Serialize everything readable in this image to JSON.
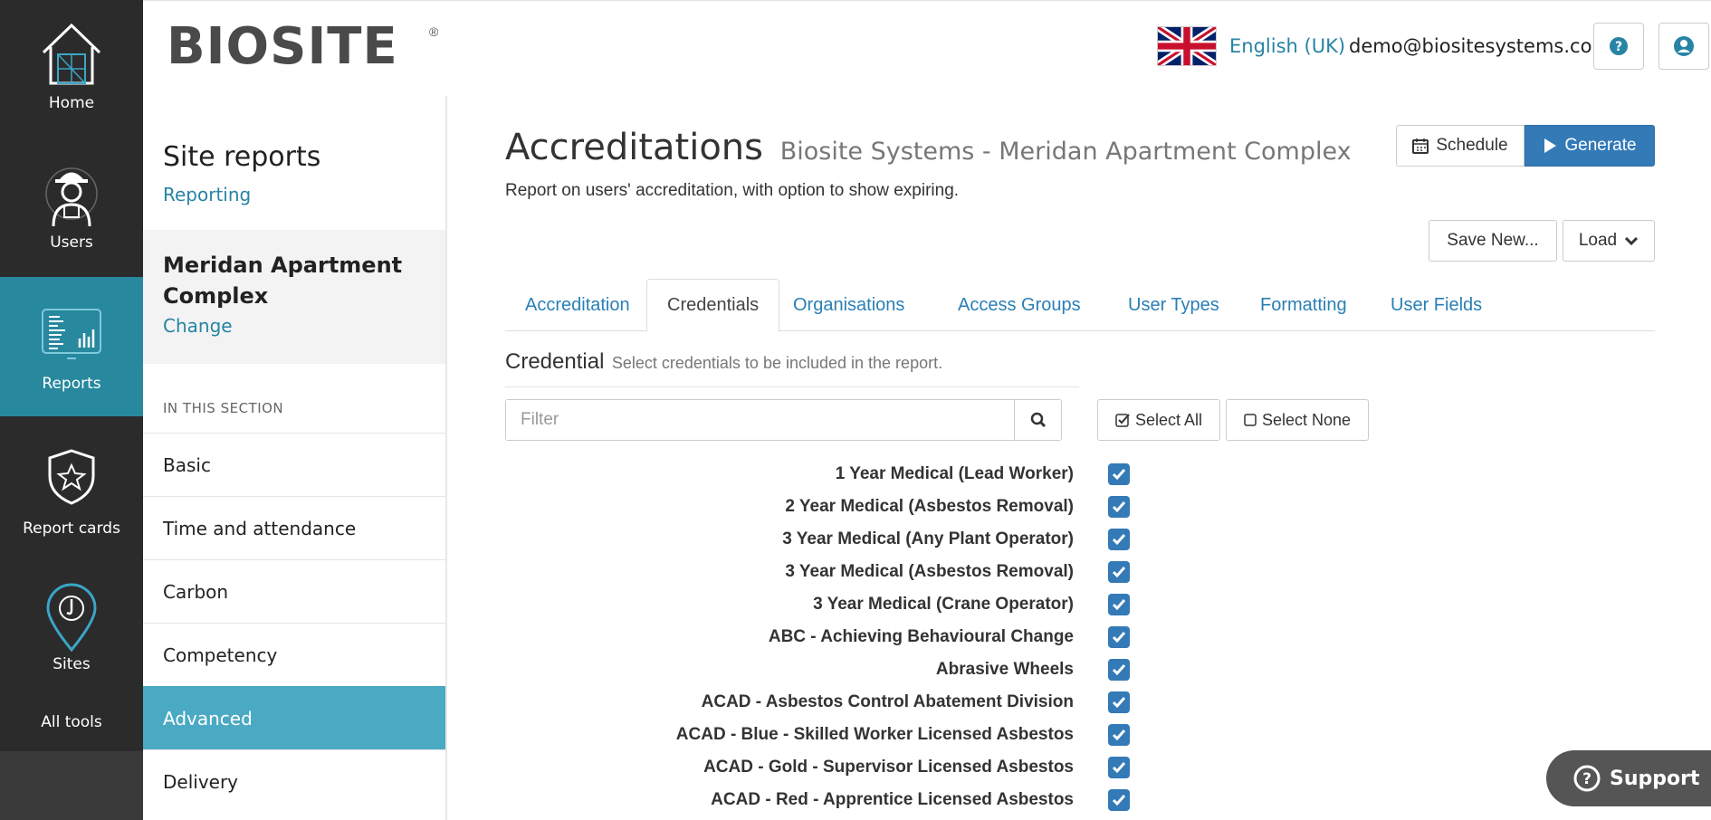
{
  "rail": {
    "items": [
      {
        "label": "Home",
        "icon": "home-icon"
      },
      {
        "label": "Users",
        "icon": "worker-icon"
      },
      {
        "label": "Reports",
        "icon": "report-icon",
        "active": true
      },
      {
        "label": "Report cards",
        "icon": "shield-star-icon"
      },
      {
        "label": "Sites",
        "icon": "location-pin-icon"
      },
      {
        "label": "All tools"
      }
    ]
  },
  "header": {
    "logo": "BIOSITE",
    "logo_mark": "®",
    "language": "English (UK)",
    "email": "demo@biositesystems.com",
    "help_icon": "question-icon",
    "account_icon": "user-icon"
  },
  "subnav": {
    "title": "Site reports",
    "link": "Reporting",
    "site_name": "Meridan Apartment Complex",
    "change_link": "Change",
    "section_label": "IN THIS SECTION",
    "items": [
      {
        "label": "Basic"
      },
      {
        "label": "Time and attendance"
      },
      {
        "label": "Carbon"
      },
      {
        "label": "Competency"
      },
      {
        "label": "Advanced",
        "active": true
      },
      {
        "label": "Delivery"
      }
    ]
  },
  "main": {
    "title": "Accreditations",
    "subtitle": "Biosite Systems - Meridan Apartment Complex",
    "description": "Report on users' accreditation, with option to show expiring.",
    "schedule_label": "Schedule",
    "generate_label": "Generate",
    "save_new_label": "Save New...",
    "load_label": "Load",
    "tabs": [
      {
        "label": "Accreditation"
      },
      {
        "label": "Credentials",
        "active": true
      },
      {
        "label": "Organisations"
      },
      {
        "label": "Access Groups"
      },
      {
        "label": "User Types"
      },
      {
        "label": "Formatting"
      },
      {
        "label": "User Fields"
      }
    ],
    "section_heading": "Credential",
    "section_description": "Select credentials to be included in the report.",
    "filter_placeholder": "Filter",
    "select_all_label": "Select All",
    "select_none_label": "Select None",
    "credentials": [
      {
        "label": "1 Year Medical (Lead Worker)",
        "checked": true
      },
      {
        "label": "2 Year Medical (Asbestos Removal)",
        "checked": true
      },
      {
        "label": "3 Year Medical (Any Plant Operator)",
        "checked": true
      },
      {
        "label": "3 Year Medical (Asbestos Removal)",
        "checked": true
      },
      {
        "label": "3 Year Medical (Crane Operator)",
        "checked": true
      },
      {
        "label": "ABC - Achieving Behavioural Change",
        "checked": true
      },
      {
        "label": "Abrasive Wheels",
        "checked": true
      },
      {
        "label": "ACAD - Asbestos Control Abatement Division",
        "checked": true
      },
      {
        "label": "ACAD - Blue - Skilled Worker Licensed Asbestos",
        "checked": true
      },
      {
        "label": "ACAD - Gold - Supervisor Licensed Asbestos",
        "checked": true
      },
      {
        "label": "ACAD - Red - Apprentice Licensed Asbestos",
        "checked": true
      }
    ]
  },
  "support_label": "Support",
  "colors": {
    "accent": "#27889e",
    "primary": "#337ab7",
    "link": "#2784a4",
    "rail": "#2b2b2b"
  }
}
